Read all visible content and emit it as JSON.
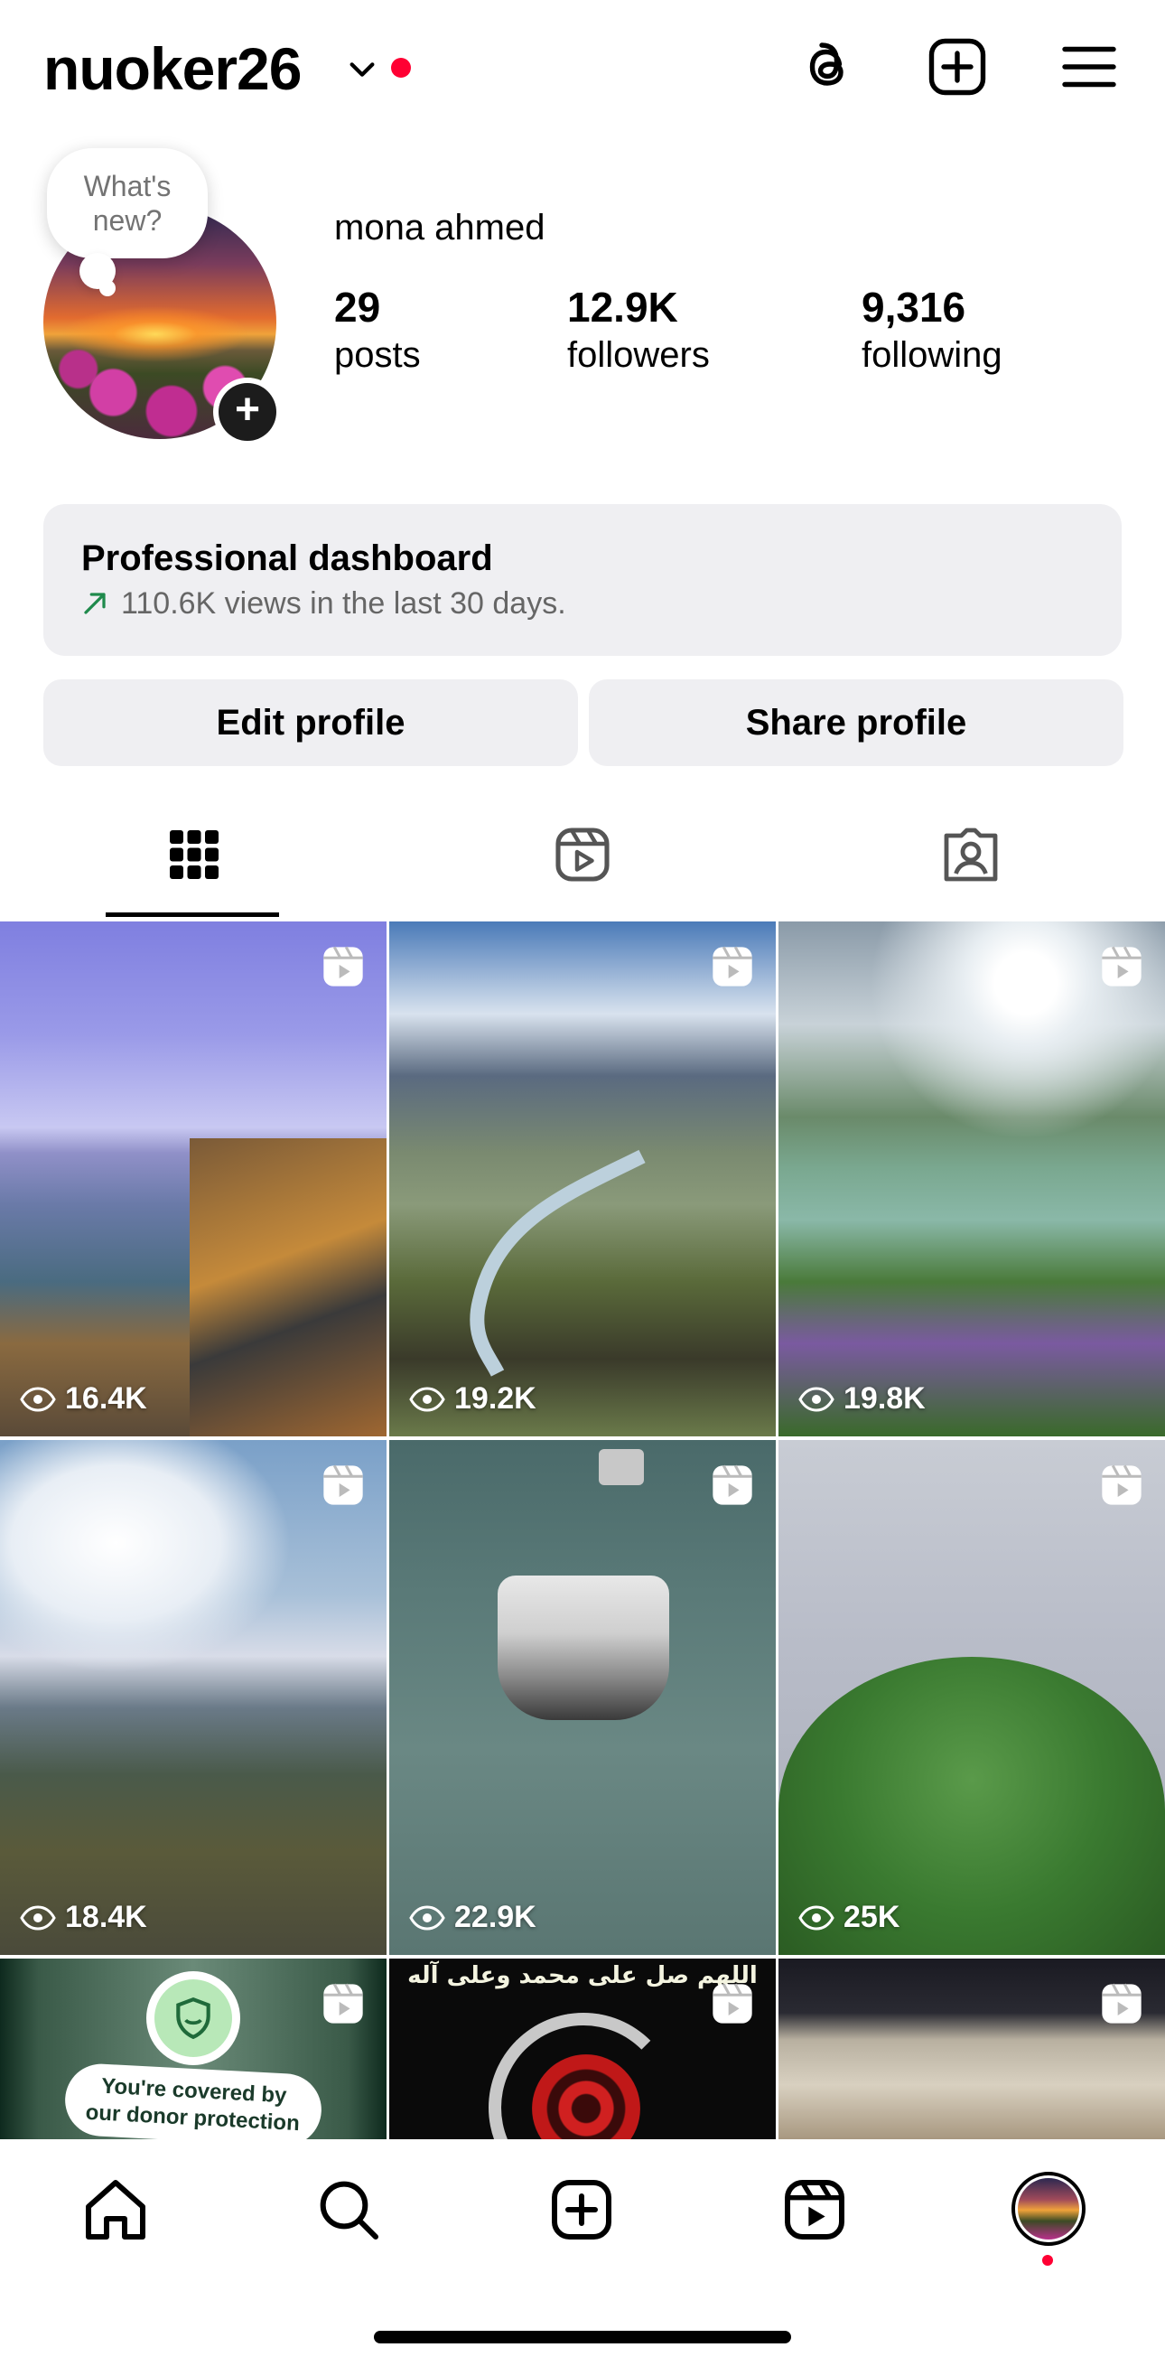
{
  "header": {
    "username": "nuoker26",
    "icons": [
      "threads-icon",
      "create-icon",
      "menu-icon"
    ]
  },
  "profile": {
    "bubble_text": "What's new?",
    "full_name": "mona ahmed",
    "stats": [
      {
        "num": "29",
        "label": "posts"
      },
      {
        "num": "12.9K",
        "label": "followers"
      },
      {
        "num": "9,316",
        "label": "following"
      }
    ]
  },
  "dashboard": {
    "title": "Professional dashboard",
    "subtitle": "110.6K views in the last 30 days.",
    "accent": "#1f8a4c"
  },
  "buttons": {
    "edit": "Edit profile",
    "share": "Share profile"
  },
  "tabs": [
    "grid-icon",
    "reels-icon",
    "tagged-icon"
  ],
  "grid": {
    "posts": [
      {
        "views": "16.4K"
      },
      {
        "views": "19.2K"
      },
      {
        "views": "19.8K"
      },
      {
        "views": "18.4K"
      },
      {
        "views": "22.9K"
      },
      {
        "views": "25K"
      },
      {
        "overlay_line1": "You're covered by",
        "overlay_line2": "our donor protection"
      },
      {
        "overlay_text": "اللهم صل على محمد وعلى آله"
      },
      {}
    ]
  },
  "bottom_nav": [
    "home-icon",
    "search-icon",
    "create-icon",
    "reels-icon",
    "profile-avatar"
  ],
  "colors": {
    "notification": "#ff0033",
    "card_bg": "#efeff2"
  }
}
